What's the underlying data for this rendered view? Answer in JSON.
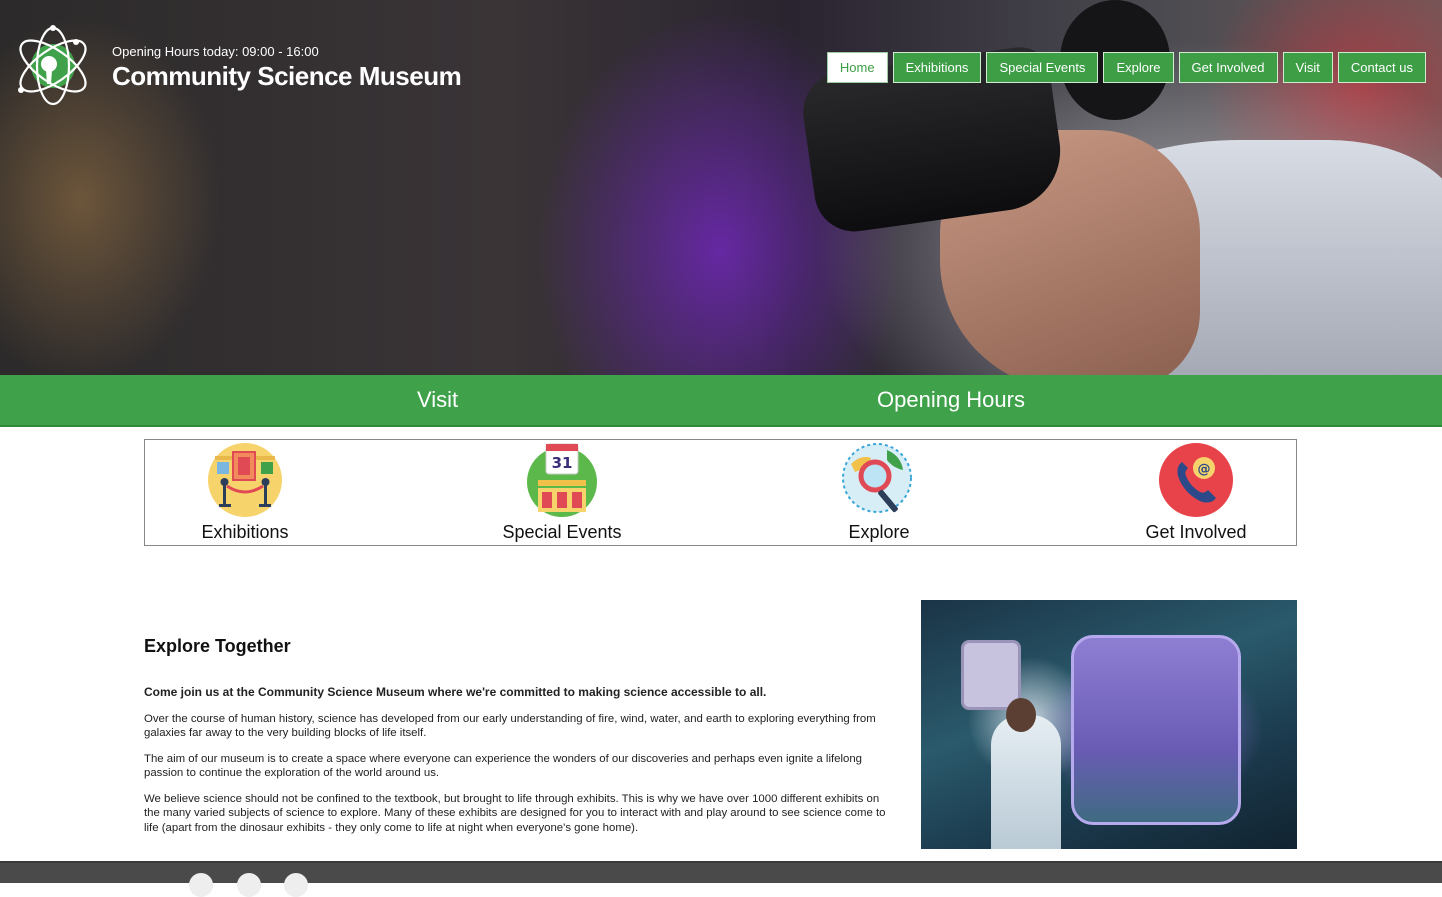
{
  "header": {
    "opening_hours": "Opening Hours today: 09:00 - 16:00",
    "site_title": "Community Science Museum"
  },
  "nav": {
    "items": [
      {
        "label": "Home",
        "active": true
      },
      {
        "label": "Exhibitions",
        "active": false
      },
      {
        "label": "Special Events",
        "active": false
      },
      {
        "label": "Explore",
        "active": false
      },
      {
        "label": "Get Involved",
        "active": false
      },
      {
        "label": "Visit",
        "active": false
      },
      {
        "label": "Contact us",
        "active": false
      }
    ]
  },
  "banner": {
    "visit": "Visit",
    "opening_hours": "Opening Hours"
  },
  "tiles": [
    {
      "label": "Exhibitions",
      "icon": "exhibition-icon"
    },
    {
      "label": "Special Events",
      "icon": "calendar-icon",
      "day": "31"
    },
    {
      "label": "Explore",
      "icon": "magnifier-globe-icon"
    },
    {
      "label": "Get Involved",
      "icon": "phone-email-icon",
      "symbol": "@"
    }
  ],
  "content": {
    "heading": "Explore Together",
    "lead": "Come join us at the Community Science Museum where we're committed to making science accessible to all.",
    "paragraphs": [
      "Over the course of human history, science has developed from our early understanding of fire, wind, water, and earth to exploring everything from galaxies far away to the very building blocks of life itself.",
      "The aim of our museum is to create a space where everyone can experience the wonders of our discoveries and perhaps even ignite a lifelong passion to continue the exploration of the world around us.",
      "We believe science should not be confined to the textbook, but brought to life through exhibits. This is why we have over 1000 different exhibits on the many varied subjects of science to explore. Many of these exhibits are designed for you to interact with and play around to see science come to life (apart from the dinosaur exhibits - they only come to life at night when everyone's gone home)."
    ]
  },
  "colors": {
    "brand_green": "#3fa14a",
    "footer_gray": "#4a4a4a"
  }
}
